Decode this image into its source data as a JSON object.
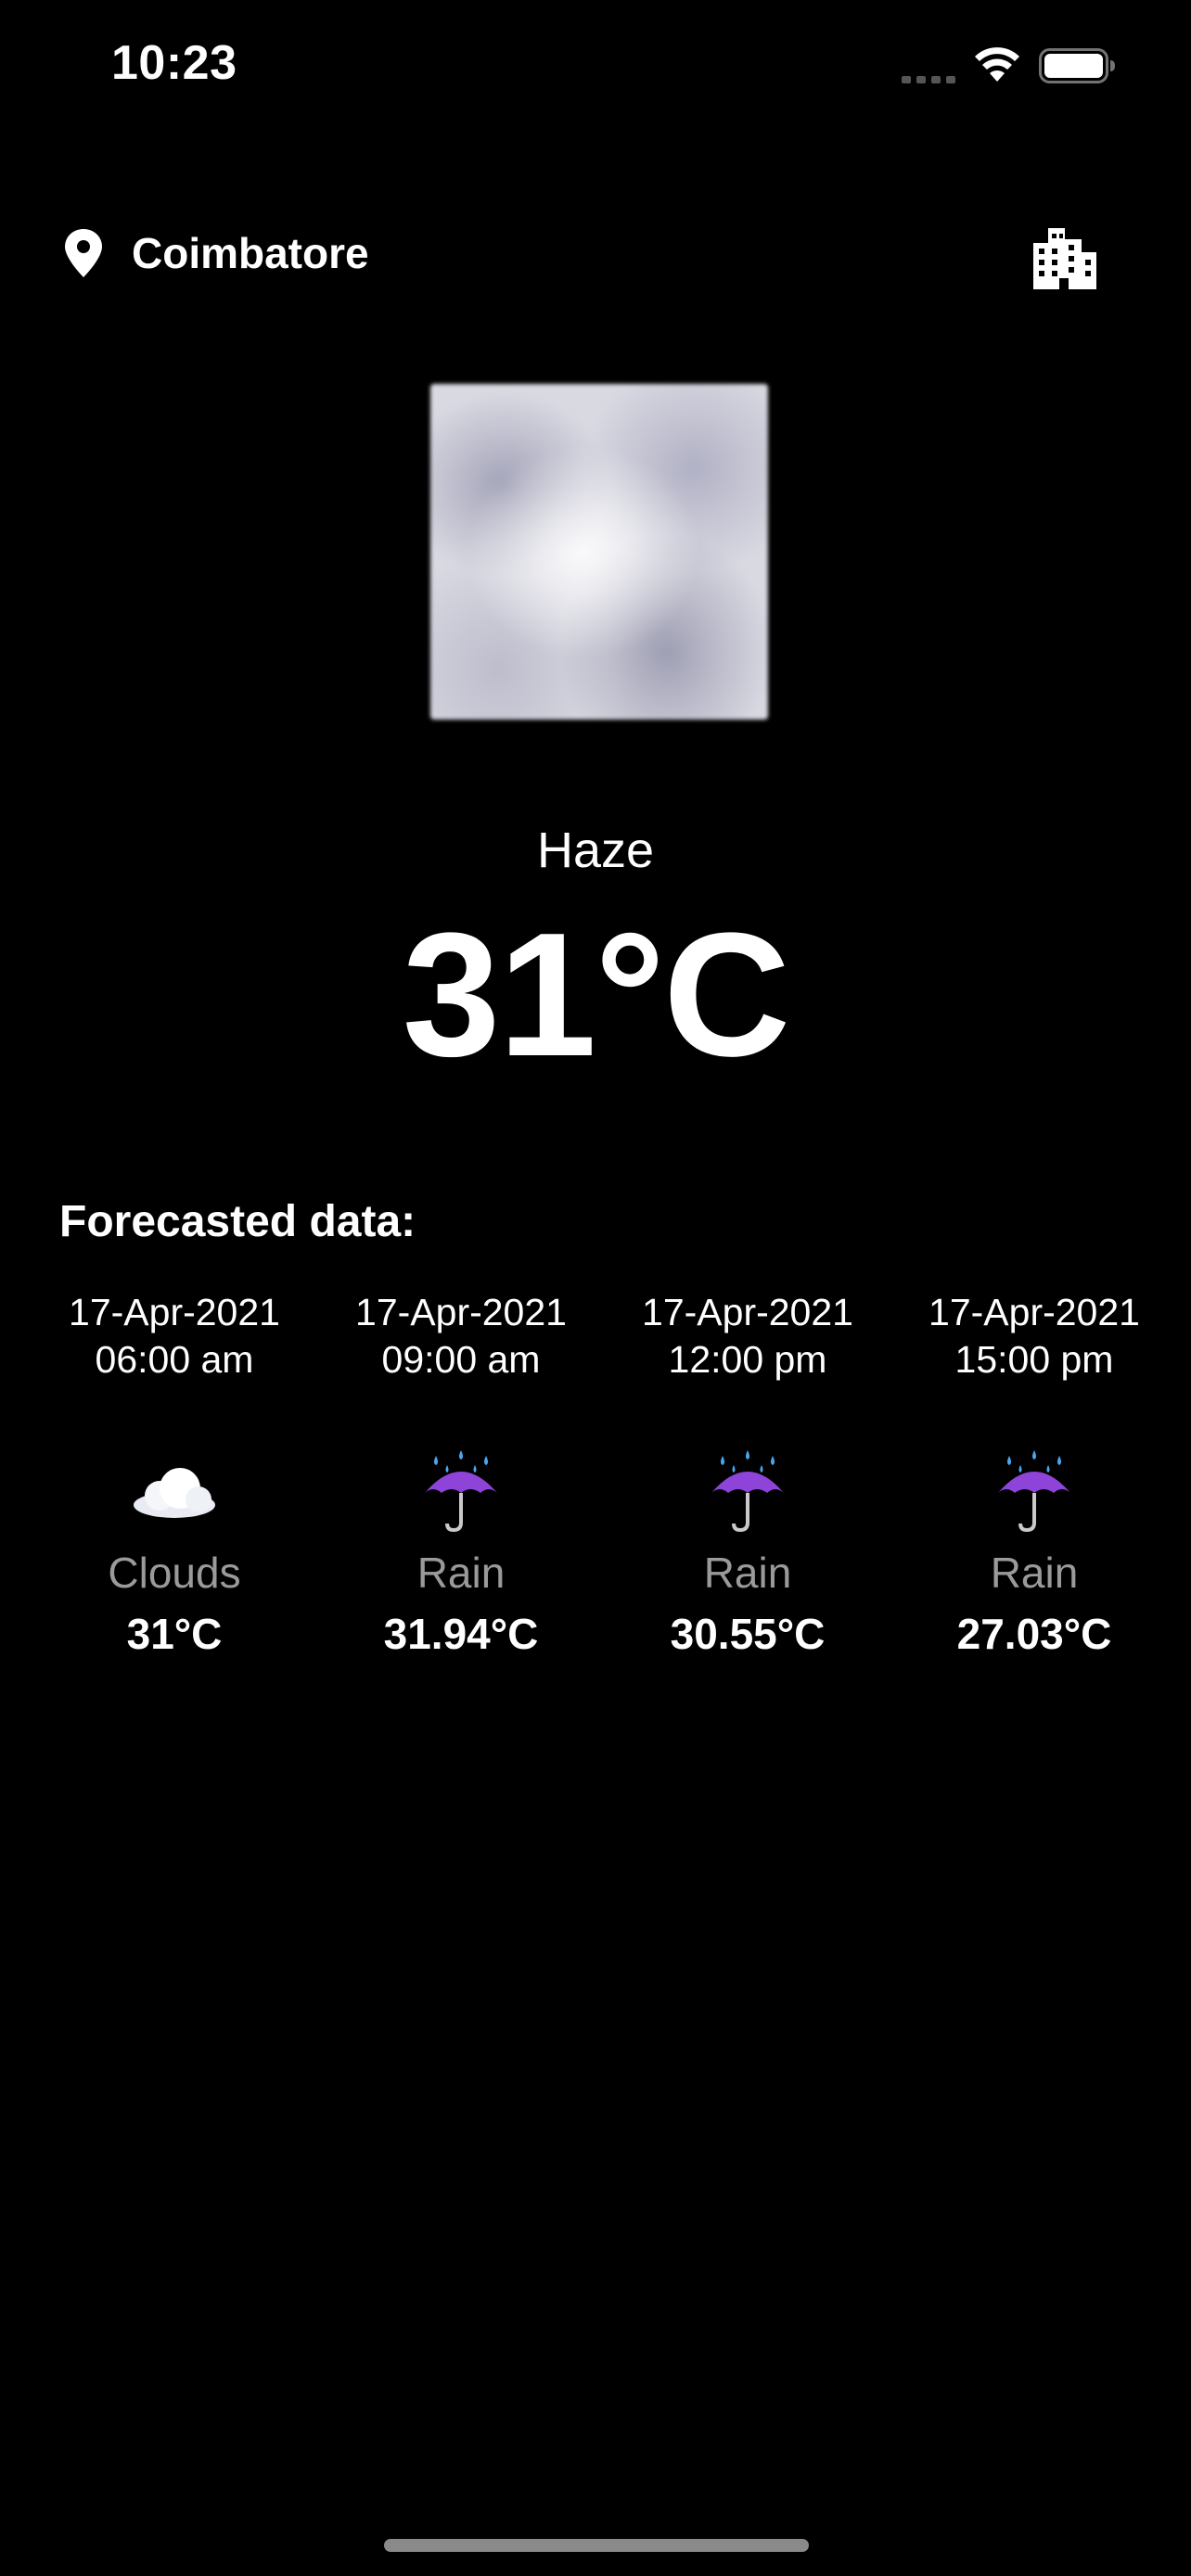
{
  "status_bar": {
    "time": "10:23"
  },
  "header": {
    "location_name": "Coimbatore",
    "location_icon": "location-pin-icon",
    "city_button_icon": "city-buildings-icon"
  },
  "current": {
    "image_description_icon": "haze-cloud-image",
    "condition": "Haze",
    "temperature": "31°C"
  },
  "forecast": {
    "heading": "Forecasted data:",
    "items": [
      {
        "date": "17-Apr-2021",
        "time": "06:00 am",
        "icon": "cloud-icon",
        "condition": "Clouds",
        "temp": "31°C"
      },
      {
        "date": "17-Apr-2021",
        "time": "09:00 am",
        "icon": "umbrella-rain-icon",
        "condition": "Rain",
        "temp": "31.94°C"
      },
      {
        "date": "17-Apr-2021",
        "time": "12:00 pm",
        "icon": "umbrella-rain-icon",
        "condition": "Rain",
        "temp": "30.55°C"
      },
      {
        "date": "17-Apr-2021",
        "time": "15:00 pm",
        "icon": "umbrella-rain-icon",
        "condition": "Rain",
        "temp": "27.03°C"
      }
    ]
  },
  "colors": {
    "background": "#000000",
    "text_primary": "#ffffff",
    "text_secondary": "#9a9a9a",
    "umbrella": "#8e44d8",
    "rain_drops": "#4aa8f0"
  }
}
